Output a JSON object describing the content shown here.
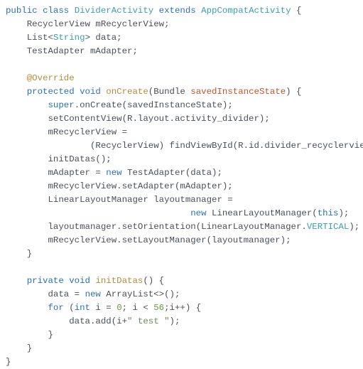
{
  "tokens": {
    "kw_public": "public",
    "kw_class": "class",
    "kw_extends": "extends",
    "kw_protected": "protected",
    "kw_private": "private",
    "kw_void": "void",
    "kw_new": "new",
    "kw_for": "for",
    "kw_int": "int",
    "kw_super": "super",
    "kw_this": "this",
    "ann_override": "@Override",
    "type_DividerActivity": "DividerActivity",
    "type_AppCompatActivity": "AppCompatActivity",
    "type_RecyclerView": "RecyclerView",
    "type_List": "List",
    "type_String": "String",
    "type_TestAdapter": "TestAdapter",
    "type_Bundle": "Bundle",
    "type_LinearLayoutManager": "LinearLayoutManager",
    "type_ArrayList": "ArrayList",
    "meth_onCreate": "onCreate",
    "meth_initDatas": "initDatas",
    "param_savedInstanceState": "savedInstanceState",
    "const_VERTICAL": "VERTICAL",
    "num_0": "0",
    "num_56": "56",
    "str_test": "\" test \"",
    "field_mRecyclerView": "mRecyclerView",
    "field_data": "data",
    "field_mAdapter": "mAdapter",
    "field_layoutmanager": "layoutmanager",
    "call_onCreate": ".onCreate(savedInstanceState);",
    "call_setContentView": "setContentView(R.layout.activity_divider);",
    "call_findViewById_prefix": "(RecyclerView) findViewById(R.id.divider_recyclerview);",
    "call_initDatas": "initDatas();",
    "call_TestAdapter_suffix": " TestAdapter(data);",
    "call_setAdapter": "mRecyclerView.setAdapter(mAdapter);",
    "call_setOrientation_prefix": "layoutmanager.setOrientation(LinearLayoutManager.",
    "call_setOrientation_suffix": ");",
    "call_setLayoutManager": "mRecyclerView.setLayoutManager(layoutmanager);",
    "call_add_prefix": "data.add(i+",
    "call_add_suffix": ");",
    "mRecyclerView_assign": "mRecyclerView =",
    "mAdapter_assign_prefix": "mAdapter = ",
    "llm_decl_prefix": "LinearLayoutManager layoutmanager =",
    "llm_new_prefix": " LinearLayoutManager(",
    "llm_new_suffix": ");",
    "data_assign_prefix": "data = ",
    "arraylist_suffix": " ArrayList<>();",
    "for_prefix": " (",
    "for_var": " i = ",
    "for_cond": "; i < ",
    "for_inc": ";i++) {",
    "semicolon": ";",
    "space": " ",
    "lt": "<",
    "gt": ">",
    "lbrace": " {",
    "rbrace": "}",
    "lparen": "(",
    "rparen": ") {"
  }
}
